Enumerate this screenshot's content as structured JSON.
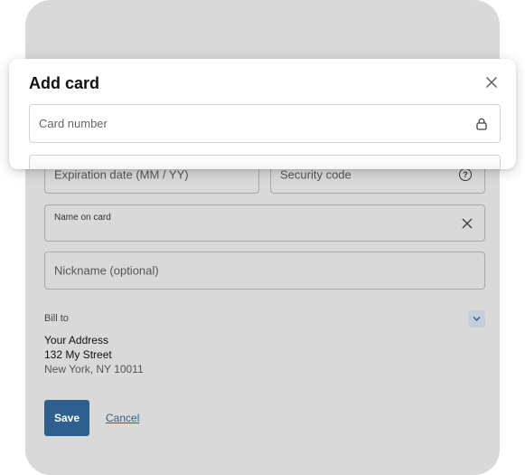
{
  "dialog": {
    "title": "Add card",
    "card_number_placeholder": "Card number"
  },
  "form": {
    "expiration_label": "Expiration date (MM / YY)",
    "security_label": "Security code",
    "name_label": "Name on card",
    "nickname_label": "Nickname (optional)"
  },
  "bill_to": {
    "label": "Bill to",
    "address_line1": "Your Address",
    "address_line2": "132 My Street",
    "address_line3": "New York, NY 10011"
  },
  "actions": {
    "save_label": "Save",
    "cancel_label": "Cancel"
  },
  "colors": {
    "primary": "#2f5f8f",
    "panel_background": "#d9d9d9"
  },
  "icons": [
    "close-icon",
    "lock-icon",
    "help-icon",
    "clear-icon",
    "chevron-down-icon"
  ]
}
